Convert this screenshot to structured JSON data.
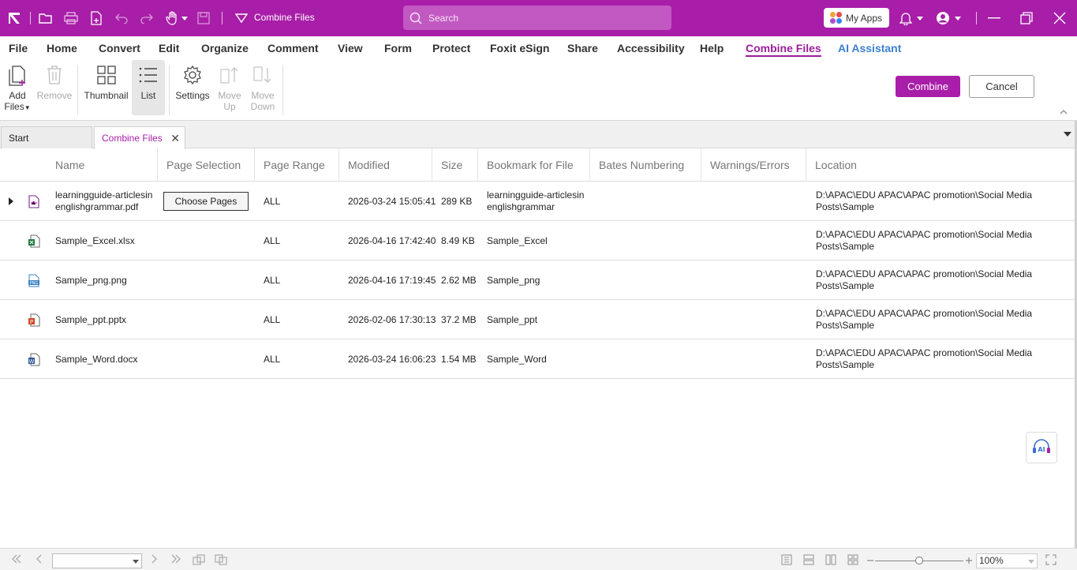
{
  "titlebar": {
    "doc_title": "Combine Files",
    "search_placeholder": "Search",
    "my_apps": "My Apps",
    "brand_color": "#a81ea8"
  },
  "menu": {
    "items": [
      "File",
      "Home",
      "Convert",
      "Edit",
      "Organize",
      "Comment",
      "View",
      "Form",
      "Protect",
      "Foxit eSign",
      "Share",
      "Accessibility",
      "Help",
      "Combine Files",
      "AI Assistant"
    ],
    "active": "Combine Files"
  },
  "ribbon": {
    "add_files_1": "Add",
    "add_files_2": "Files",
    "remove": "Remove",
    "thumbnail": "Thumbnail",
    "list": "List",
    "settings": "Settings",
    "move_up_1": "Move",
    "move_up_2": "Up",
    "move_down_1": "Move",
    "move_down_2": "Down",
    "combine": "Combine",
    "cancel": "Cancel"
  },
  "tabs": {
    "start": "Start",
    "current": "Combine Files"
  },
  "table": {
    "headers": [
      "Name",
      "Page Selection",
      "Page Range",
      "Modified",
      "Size",
      "Bookmark for File",
      "Bates Numbering",
      "Warnings/Errors",
      "Location"
    ],
    "choose_pages": "Choose Pages",
    "rows": [
      {
        "name_1": "learningguide-articlesin",
        "name_2": "englishgrammar.pdf",
        "icon": "pdf-file-icon",
        "range": "ALL",
        "modified": "2026-03-24 15:05:41",
        "size": "289 KB",
        "bookmark_1": "learningguide-articlesin",
        "bookmark_2": "englishgrammar",
        "location_1": "D:\\APAC\\EDU APAC\\APAC promotion\\Social Media",
        "location_2": "Posts\\Sample"
      },
      {
        "name_1": "Sample_Excel.xlsx",
        "name_2": "",
        "icon": "excel-file-icon",
        "range": "ALL",
        "modified": "2026-04-16 17:42:40",
        "size": "8.49 KB",
        "bookmark_1": "Sample_Excel",
        "bookmark_2": "",
        "location_1": "D:\\APAC\\EDU APAC\\APAC promotion\\Social Media",
        "location_2": "Posts\\Sample"
      },
      {
        "name_1": "Sample_png.png",
        "name_2": "",
        "icon": "png-file-icon",
        "range": "ALL",
        "modified": "2026-04-16 17:19:45",
        "size": "2.62 MB",
        "bookmark_1": "Sample_png",
        "bookmark_2": "",
        "location_1": "D:\\APAC\\EDU APAC\\APAC promotion\\Social Media",
        "location_2": "Posts\\Sample"
      },
      {
        "name_1": "Sample_ppt.pptx",
        "name_2": "",
        "icon": "pptx-file-icon",
        "range": "ALL",
        "modified": "2026-02-06 17:30:13",
        "size": "37.2 MB",
        "bookmark_1": "Sample_ppt",
        "bookmark_2": "",
        "location_1": "D:\\APAC\\EDU APAC\\APAC promotion\\Social Media",
        "location_2": "Posts\\Sample"
      },
      {
        "name_1": "Sample_Word.docx",
        "name_2": "",
        "icon": "word-file-icon",
        "range": "ALL",
        "modified": "2026-03-24 16:06:23",
        "size": "1.54 MB",
        "bookmark_1": "Sample_Word",
        "bookmark_2": "",
        "location_1": "D:\\APAC\\EDU APAC\\APAC promotion\\Social Media",
        "location_2": "Posts\\Sample"
      }
    ]
  },
  "statusbar": {
    "page_input": "",
    "zoom": "100%",
    "zoom_level": 0.5
  }
}
